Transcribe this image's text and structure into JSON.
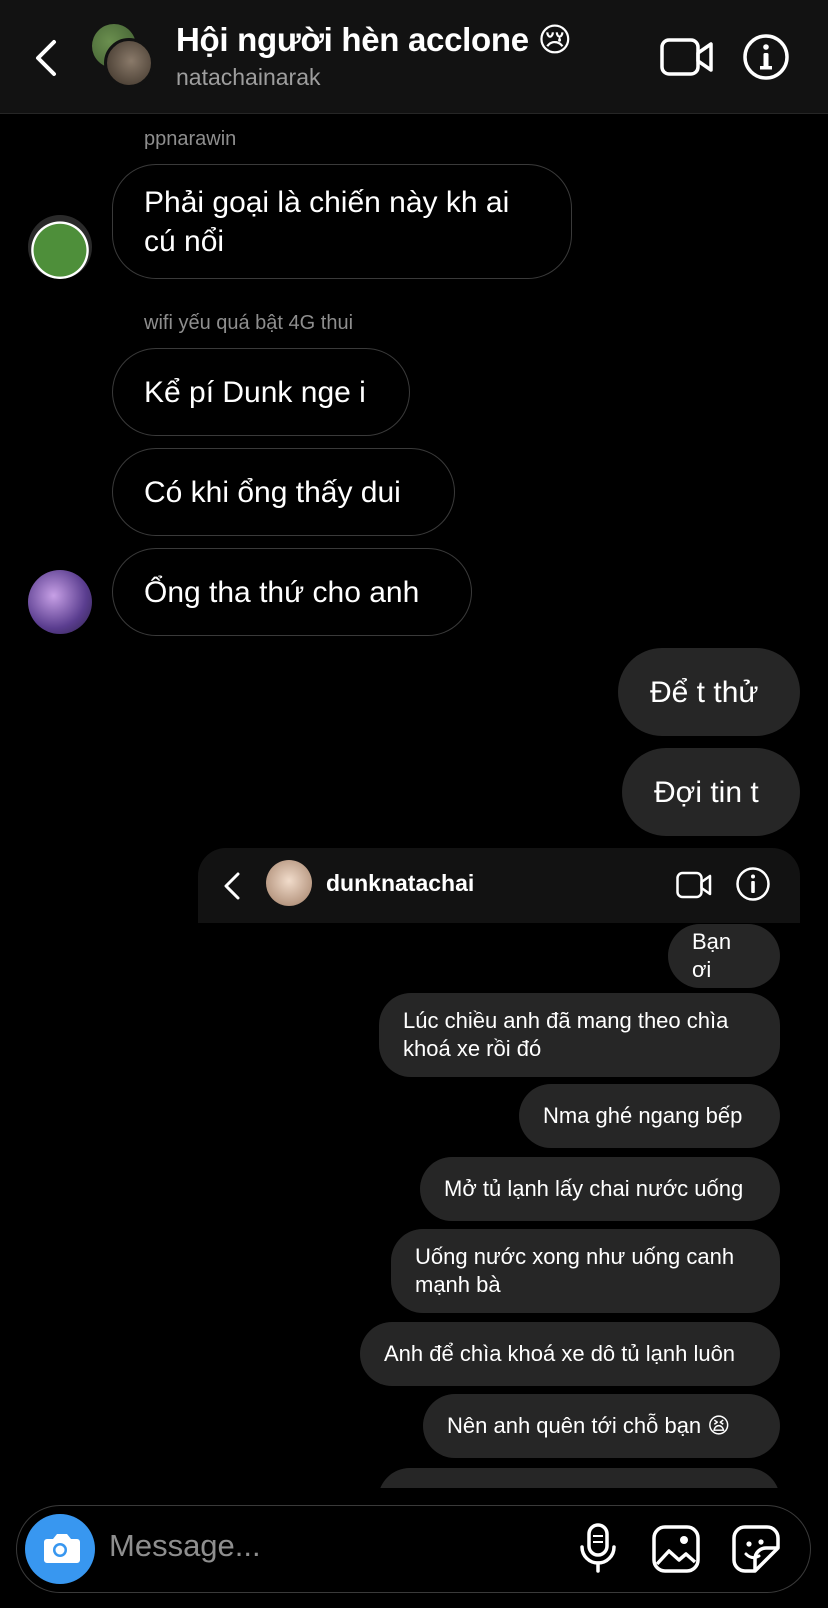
{
  "header": {
    "title": "Hội người hèn acclone",
    "emoji": "😢",
    "subtitle": "natachainarak"
  },
  "messages": {
    "sender1": "ppnarawin",
    "m1_line1": "Phải goại là chiến này kh ai",
    "m1_line2": "cú nổi",
    "sender2": "wifi yếu quá bật 4G thui",
    "m2": "Kể pí Dunk nge i",
    "m3": "Có khi ổng thấy dui",
    "m4": "Ổng tha thứ cho anh",
    "mine1": "Để t thử",
    "mine2": "Đợi tin t"
  },
  "embedded": {
    "username": "dunknatachai",
    "msgs": [
      "Bạn ơi",
      "Lúc chiều anh đã mang theo chìa\nkhoá xe rồi đó",
      "Nma ghé ngang bếp",
      "Mở tủ lạnh lấy chai nước uống",
      "Uống nước xong như uống canh\nmạnh bà",
      "Anh để chìa khoá xe dô tủ lạnh luôn",
      "Nên anh quên tới chỗ bạn 😫"
    ]
  },
  "composer": {
    "placeholder": "Message..."
  },
  "colors": {
    "accent": "#3897f0",
    "bubble_outgoing": "#262626",
    "header_bg": "#121212"
  }
}
